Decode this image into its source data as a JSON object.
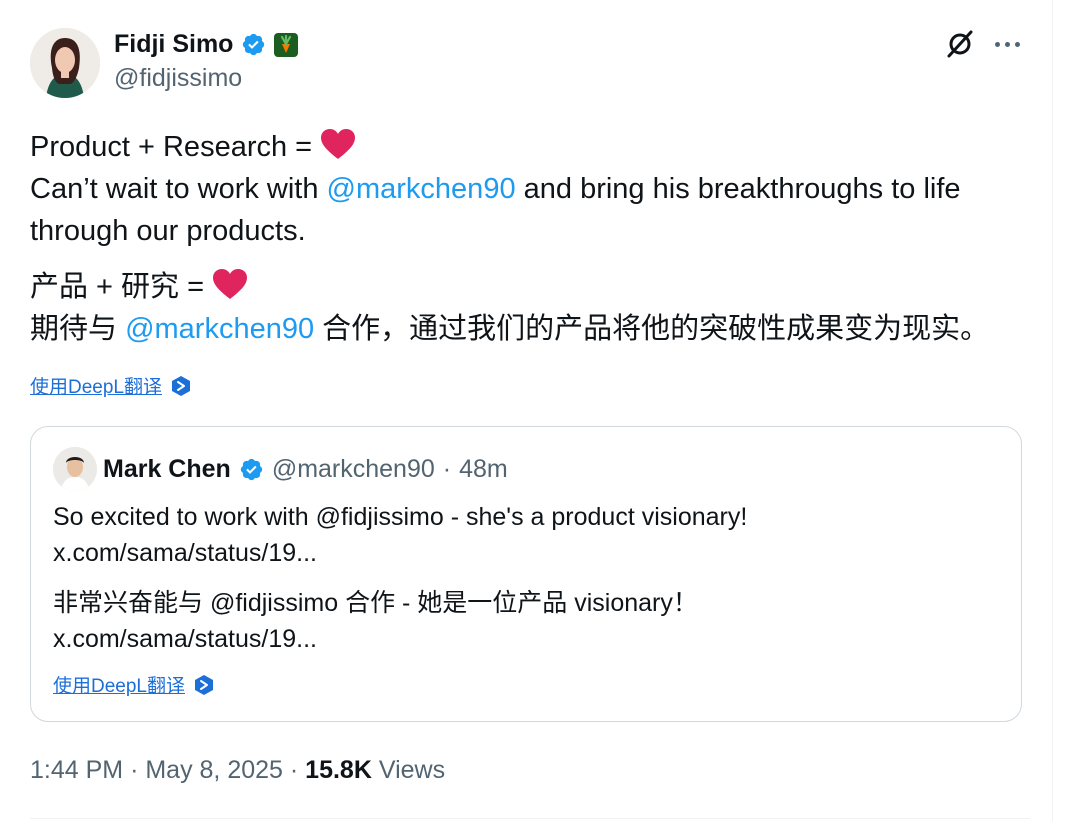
{
  "tweet": {
    "author": {
      "name": "Fidji Simo",
      "handle": "@fidjissimo"
    },
    "text": {
      "line1": "Product + Research = ",
      "line2_pre": "Can’t wait to work with ",
      "line2_mention": "@markchen90",
      "line2_post": " and bring his breakthroughs to life through our products.",
      "zh_line1": "产品 + 研究 = ",
      "zh_line2_pre": "期待与 ",
      "zh_line2_mention": "@markchen90",
      "zh_line2_post": " 合作，通过我们的产品将他的突破性成果变为现实。"
    },
    "translate_label": "使用DeepL翻译",
    "time": "1:44 PM",
    "date": "May 8, 2025",
    "views_count": "15.8K",
    "views_label": "Views",
    "separator": "·"
  },
  "quote": {
    "author": {
      "name": "Mark Chen",
      "handle": "@markchen90",
      "time": "48m"
    },
    "text": {
      "line1": "So excited to work with @fidjissimo - she's a product visionary!",
      "link1": "x.com/sama/status/19...",
      "zh_line1": "非常兴奋能与 @fidjissimo 合作 - 她是一位产品 visionary！",
      "link2": "x.com/sama/status/19..."
    },
    "translate_label": "使用DeepL翻译"
  },
  "colors": {
    "accent": "#1d9bf0",
    "text": "#0f1419",
    "muted": "#536471",
    "translate_link": "#1d6fd8",
    "heart": "#e0245e",
    "verified": "#1d9bf0"
  },
  "icons": {
    "verified": "verified-badge-icon",
    "affiliate": "affiliate-badge-icon",
    "grok": "grok-icon",
    "more": "more-options-icon",
    "heart": "heart-emoji-icon",
    "deepl": "deepl-icon"
  }
}
